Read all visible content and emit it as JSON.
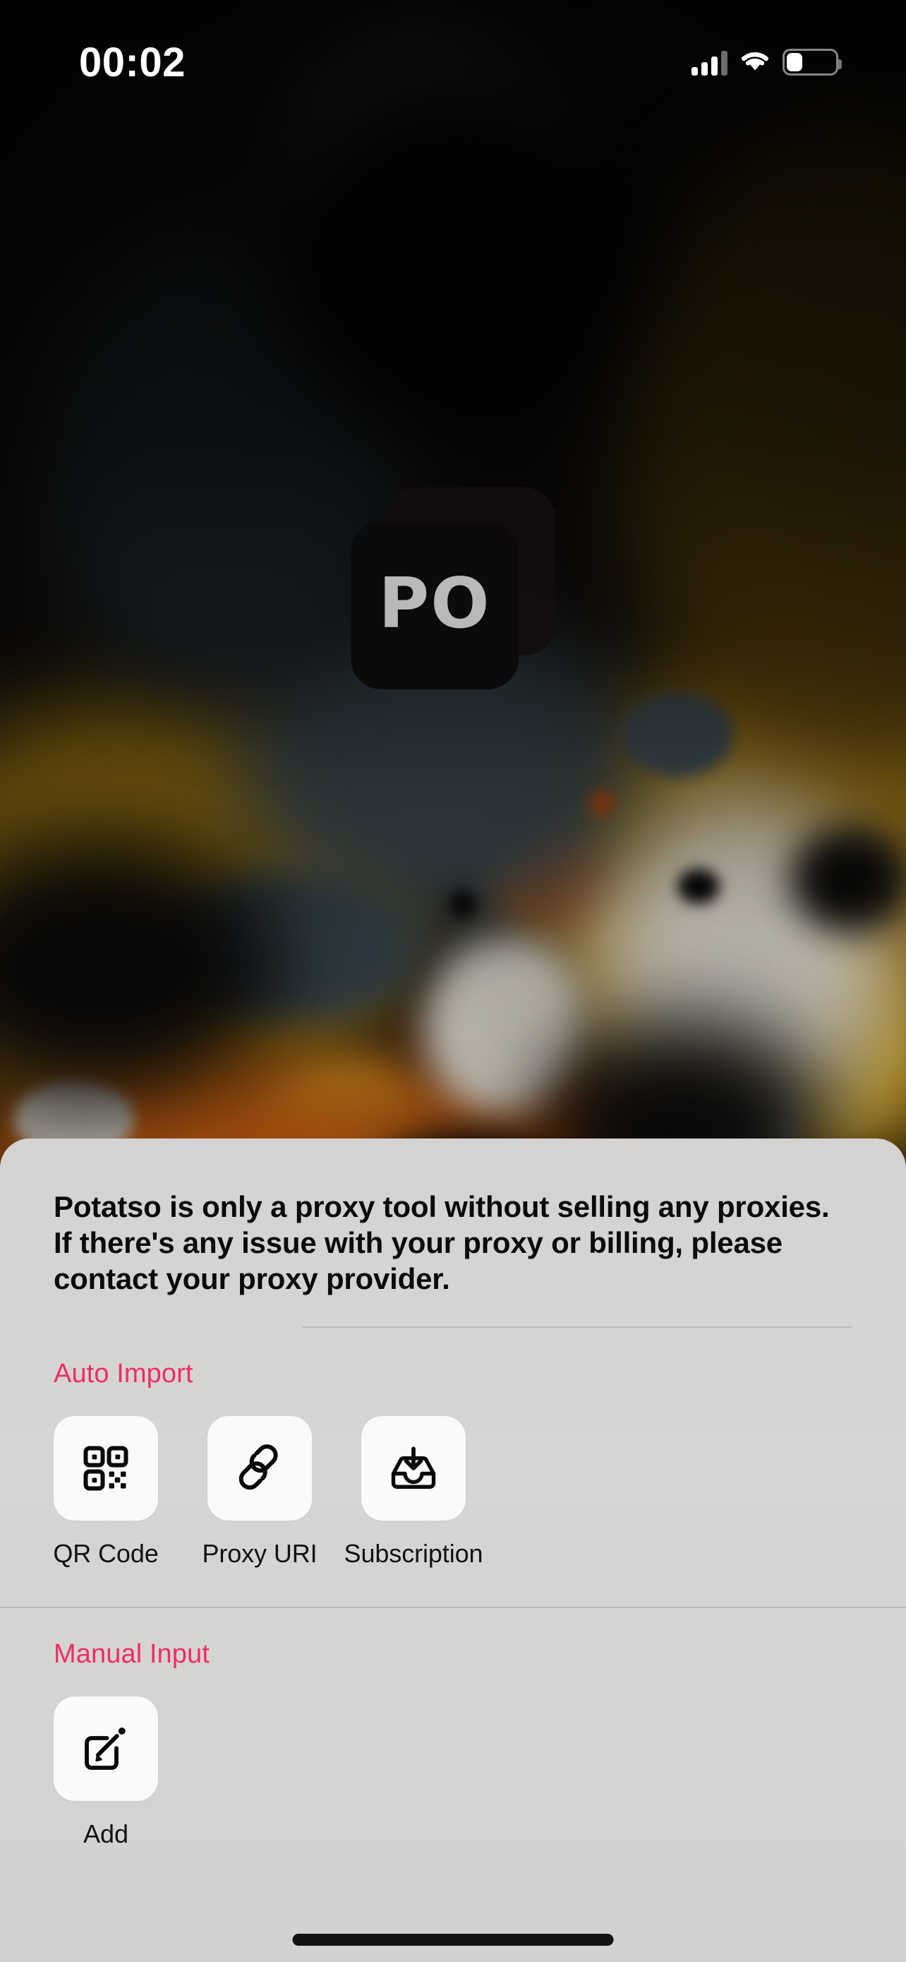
{
  "status_bar": {
    "time": "00:02",
    "cellular_icon": "cellular-bars-icon",
    "wifi_icon": "wifi-icon",
    "battery_icon": "battery-low-icon",
    "battery_level_percent": 25
  },
  "wallpaper": {
    "name": "abstract-paint-splatter-wallpaper",
    "colors": [
      "#0d0c0b",
      "#9a7412",
      "#b5560f",
      "#3c4a52",
      "#d8d2c6",
      "#c9a22a"
    ]
  },
  "app_logo": {
    "name": "potatso-app-icon",
    "text": "PO",
    "tile_color": "#0d0b0a",
    "text_color": "#b9b9b9"
  },
  "sheet": {
    "disclaimer": "Potatso is only a proxy tool without selling any proxies. If there's any issue with your proxy or billing, please contact your proxy provider.",
    "accent_color": "#ef2d66",
    "background_color": "#d5d4d2",
    "sections": [
      {
        "title": "Auto Import",
        "items": [
          {
            "label": "QR Code",
            "icon": "qr-code-icon"
          },
          {
            "label": "Proxy URI",
            "icon": "link-chain-icon"
          },
          {
            "label": "Subscription",
            "icon": "tray-download-icon"
          }
        ]
      },
      {
        "title": "Manual Input",
        "items": [
          {
            "label": "Add",
            "icon": "compose-pencil-square-icon"
          }
        ]
      }
    ]
  },
  "home_indicator": {
    "name": "home-indicator",
    "color": "#131313"
  }
}
